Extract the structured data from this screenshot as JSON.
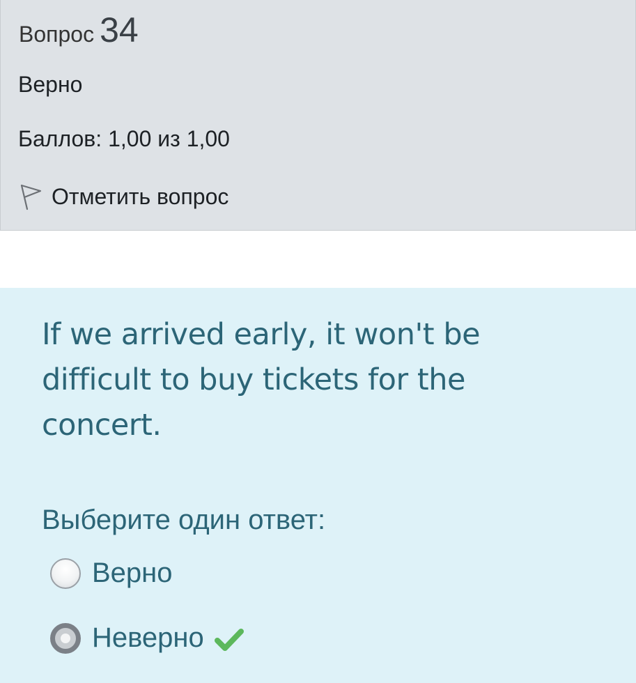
{
  "question_info": {
    "label": "Вопрос",
    "number": "34",
    "state": "Верно",
    "grade": "Баллов: 1,00 из 1,00",
    "flag_label": "Отметить вопрос",
    "flag_icon": "flag-outline-icon"
  },
  "question": {
    "text": "If we arrived early, it won't be difficult to buy tickets for the concert.",
    "prompt": "Выберите один ответ:",
    "options": [
      {
        "label": "Верно",
        "selected": false
      },
      {
        "label": "Неверно",
        "selected": true,
        "marked_correct": true
      }
    ]
  },
  "colors": {
    "info_background": "#dee2e6",
    "content_background": "#def2f8",
    "question_text": "#2c6577",
    "correct_check": "#5cb85c"
  }
}
